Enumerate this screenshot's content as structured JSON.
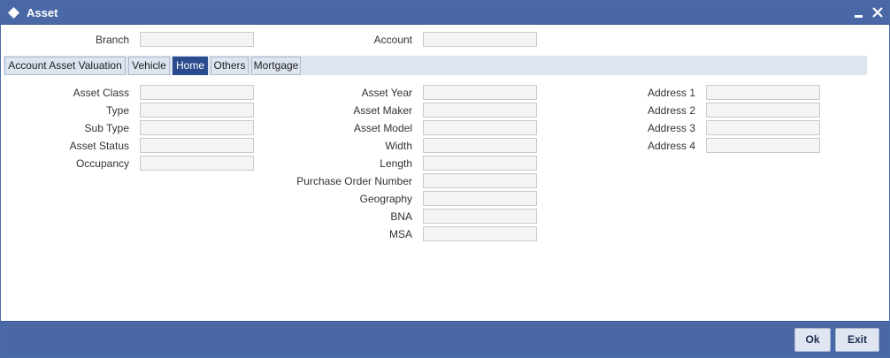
{
  "window": {
    "title": "Asset",
    "minimize_icon": "minimize-icon",
    "close_icon": "close-icon"
  },
  "header": {
    "branch_label": "Branch",
    "branch_value": "",
    "account_label": "Account",
    "account_value": ""
  },
  "tabs": [
    {
      "label": "Account Asset Valuation",
      "active": false
    },
    {
      "label": "Vehicle",
      "active": false
    },
    {
      "label": "Home",
      "active": true
    },
    {
      "label": "Others",
      "active": false
    },
    {
      "label": "Mortgage",
      "active": false
    }
  ],
  "col1": {
    "asset_class": {
      "label": "Asset Class",
      "value": ""
    },
    "type": {
      "label": "Type",
      "value": ""
    },
    "sub_type": {
      "label": "Sub Type",
      "value": ""
    },
    "asset_status": {
      "label": "Asset Status",
      "value": ""
    },
    "occupancy": {
      "label": "Occupancy",
      "value": ""
    }
  },
  "col2": {
    "asset_year": {
      "label": "Asset Year",
      "value": ""
    },
    "asset_maker": {
      "label": "Asset Maker",
      "value": ""
    },
    "asset_model": {
      "label": "Asset Model",
      "value": ""
    },
    "width": {
      "label": "Width",
      "value": ""
    },
    "length": {
      "label": "Length",
      "value": ""
    },
    "purchase_order_number": {
      "label": "Purchase Order Number",
      "value": ""
    },
    "geography": {
      "label": "Geography",
      "value": ""
    },
    "bna": {
      "label": "BNA",
      "value": ""
    },
    "msa": {
      "label": "MSA",
      "value": ""
    }
  },
  "col3": {
    "address_1": {
      "label": "Address 1",
      "value": ""
    },
    "address_2": {
      "label": "Address 2",
      "value": ""
    },
    "address_3": {
      "label": "Address 3",
      "value": ""
    },
    "address_4": {
      "label": "Address 4",
      "value": ""
    }
  },
  "footer": {
    "ok_label": "Ok",
    "exit_label": "Exit"
  },
  "colors": {
    "titlebar": "#4a68a5",
    "active_tab": "#2a4c8e",
    "tabbar": "#dde5f1"
  }
}
